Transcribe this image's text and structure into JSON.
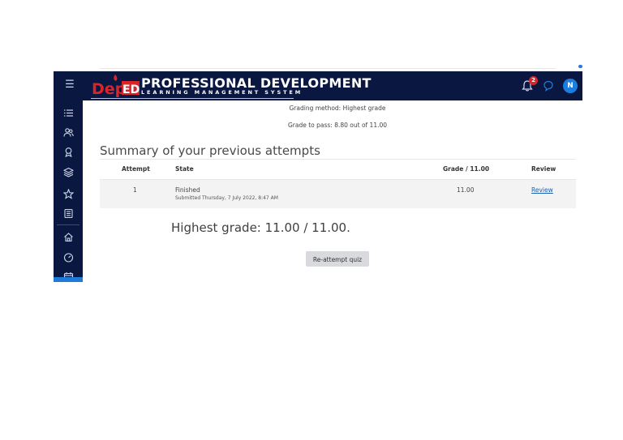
{
  "header": {
    "logo_text": "DepED",
    "title": "PROFESSIONAL DEVELOPMENT",
    "subtitle": "LEARNING MANAGEMENT SYSTEM",
    "notification_count": "2",
    "avatar_initial": "N"
  },
  "sidebar": {
    "icons": [
      "list-icon",
      "users-icon",
      "award-icon",
      "layers-icon",
      "star-icon",
      "book-icon",
      "home-icon",
      "dashboard-icon",
      "calendar-icon"
    ]
  },
  "quiz": {
    "grading_method": "Grading method: Highest grade",
    "grade_to_pass": "Grade to pass: 8.80 out of 11.00"
  },
  "summary": {
    "heading": "Summary of your previous attempts",
    "columns": [
      "Attempt",
      "State",
      "Grade / 11.00",
      "Review"
    ],
    "rows": [
      {
        "attempt": "1",
        "state": "Finished",
        "submitted": "Submitted Thursday, 7 July 2022, 8:47 AM",
        "grade": "11.00",
        "review": "Review"
      }
    ]
  },
  "result": {
    "highest_grade": "Highest grade: 11.00 / 11.00."
  },
  "actions": {
    "reattempt_label": "Re-attempt quiz"
  },
  "colors": {
    "navbar": "#0a1741",
    "accent": "#1a7fe0",
    "badge": "#d9252a",
    "link": "#1a5fb4"
  }
}
